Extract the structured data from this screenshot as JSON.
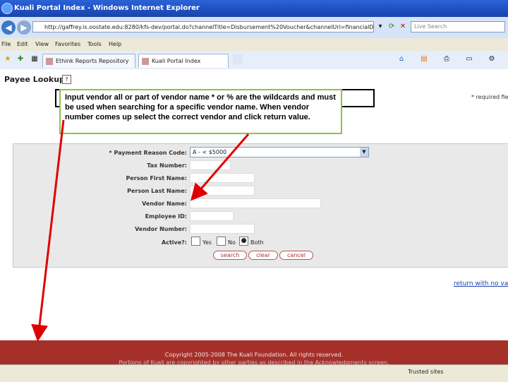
{
  "window": {
    "title": "Kuali Portal Index - Windows Internet Explorer"
  },
  "addressbar": {
    "url": "http://gaffrey.is.oostate.edu:8280/kfs-dev/portal.do?channelTitle=Disbursement%20Voucher&channelUrl=financialDisbursem",
    "search_placeholder": "Live Search"
  },
  "menu": [
    "File",
    "Edit",
    "View",
    "Favorites",
    "Tools",
    "Help"
  ],
  "tabs": [
    {
      "label": "Ethink Reports Repository"
    },
    {
      "label": "Kuali Portal Index"
    }
  ],
  "page": {
    "title": "Payee Lookup",
    "required_note": "* required fie"
  },
  "callout": {
    "text": "Input vendor all or part of vendor name * or % are the wildcards and must be used when searching for a specific vendor name. When vendor number comes up select the correct vendor and click return value."
  },
  "form": {
    "payment_reason": {
      "label": "* Payment Reason Code:",
      "value": "A - < $5000"
    },
    "tax_number": {
      "label": "Tax Number:"
    },
    "first_name": {
      "label": "Person First Name:"
    },
    "last_name": {
      "label": "Person Last Name:"
    },
    "vendor_name": {
      "label": "Vendor Name:"
    },
    "employee_id": {
      "label": "Employee ID:"
    },
    "vendor_number": {
      "label": "Vendor Number:"
    },
    "active": {
      "label": "Active?:",
      "options": [
        "Yes",
        "No",
        "Both"
      ],
      "selected": "Both"
    }
  },
  "buttons": {
    "search": "search",
    "clear": "clear",
    "cancel": "cancel"
  },
  "return_link": "return with no va",
  "footer": {
    "copyright": "Copyright 2005-2008 The Kuali Foundation. All rights reserved.",
    "portions": "Portions of Kuali are copyrighted by other parties as described in the Acknowledgments screen."
  },
  "status": {
    "zone": "Trusted sites"
  },
  "colors": {
    "callout_border": "#8bc34a",
    "arrow": "#e00000",
    "footer": "#a5302a"
  }
}
